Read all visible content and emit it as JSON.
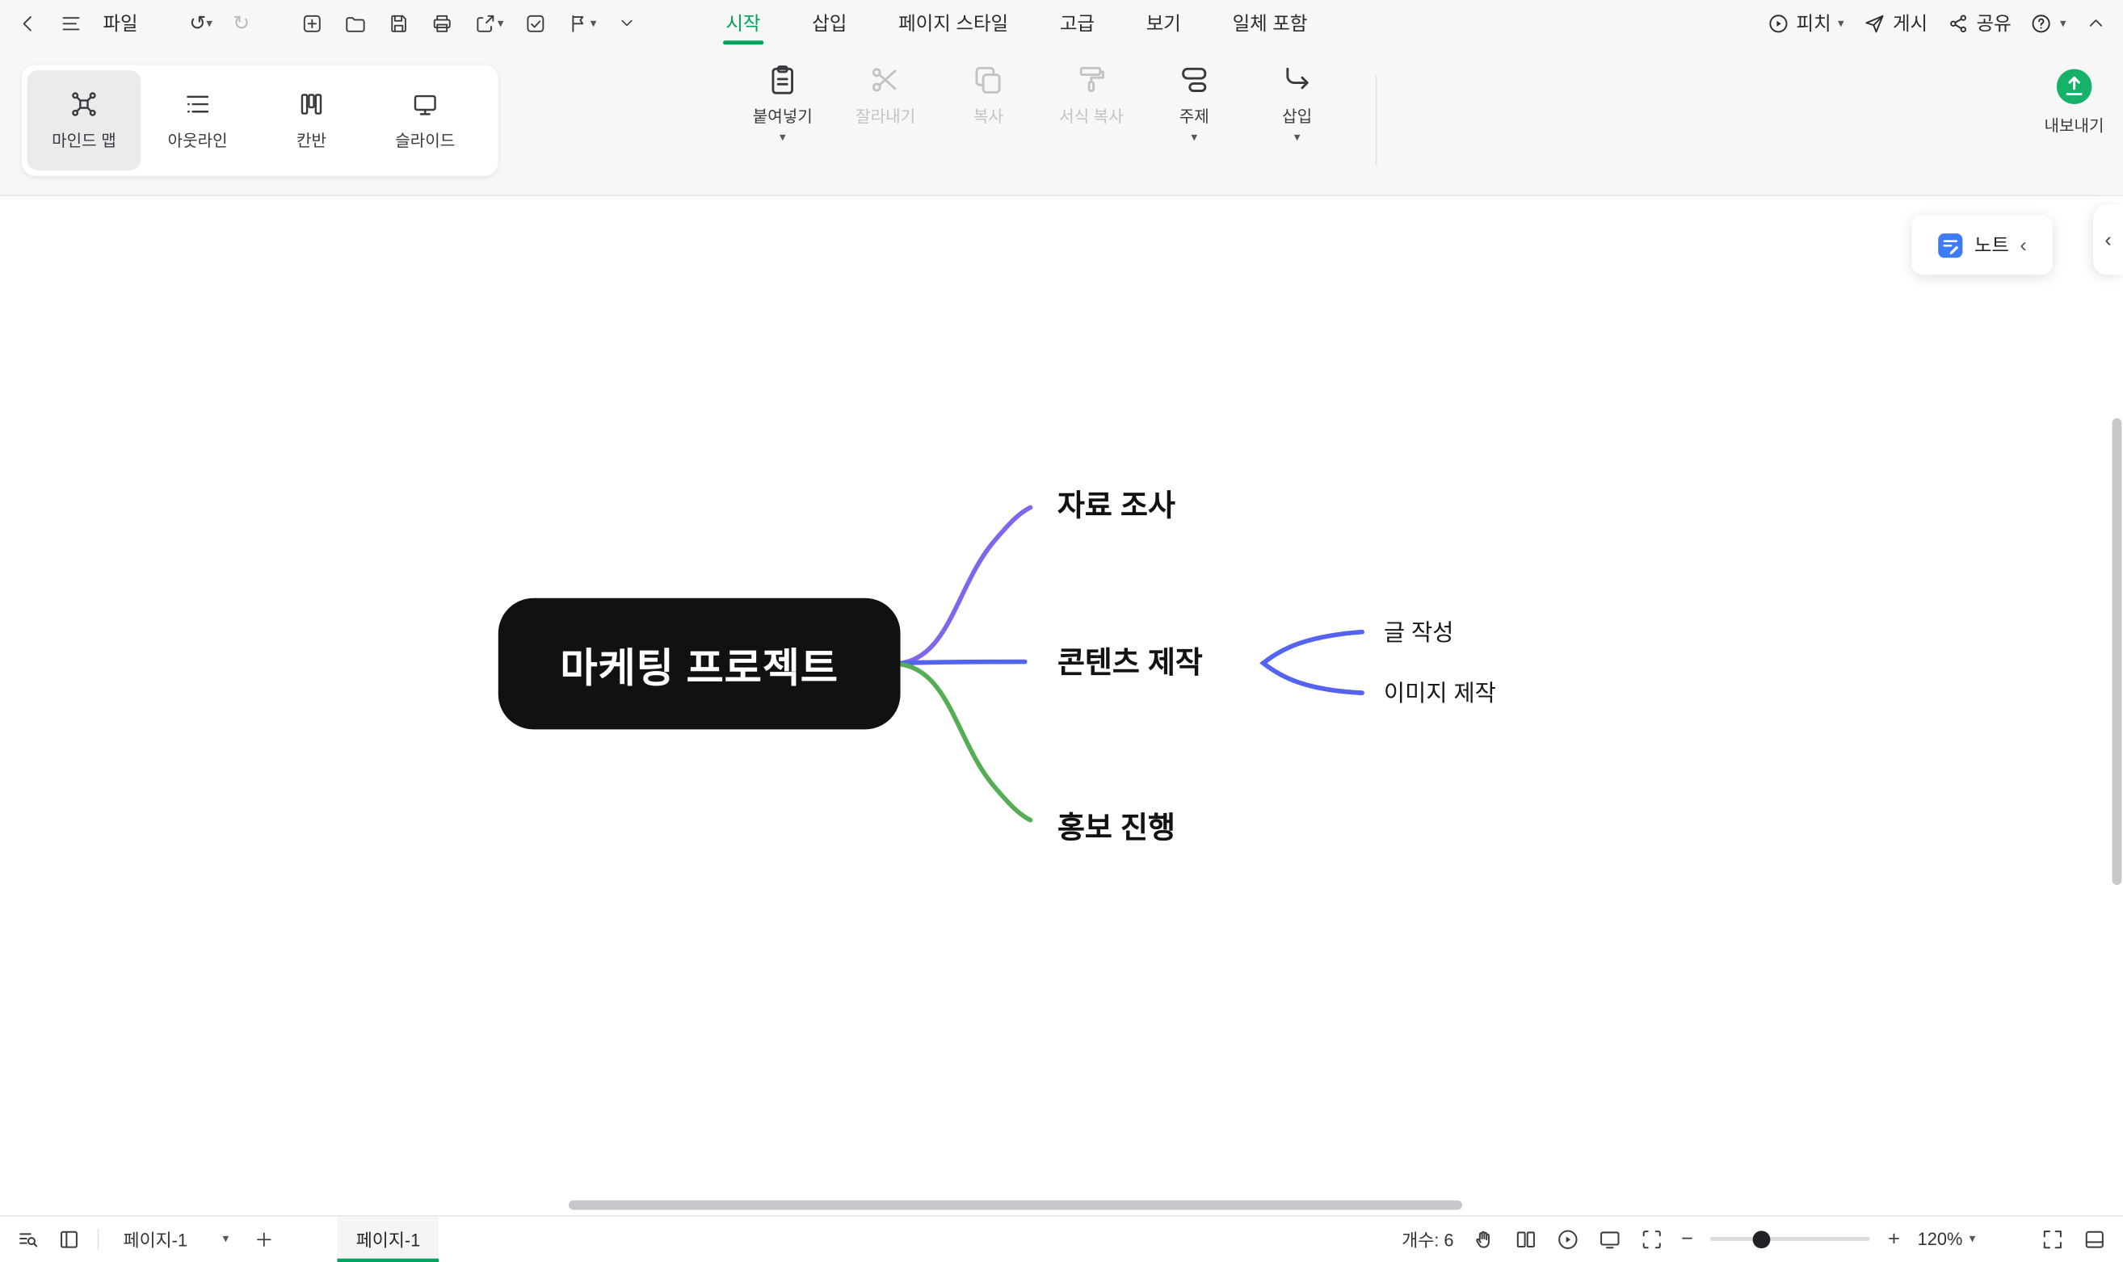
{
  "icons": {
    "undo": "↺",
    "redo": "↻",
    "caret_down": "▾",
    "chevron_left": "‹",
    "minus": "−",
    "plus": "+"
  },
  "colors": {
    "accent_green": "#00a45e",
    "export_green": "#17b26a",
    "note_blue": "#3e7bfa"
  },
  "menubar": {
    "file": "파일",
    "tabs": [
      {
        "label": "시작",
        "active": true
      },
      {
        "label": "삽입",
        "active": false
      },
      {
        "label": "페이지 스타일",
        "active": false
      },
      {
        "label": "고급",
        "active": false
      },
      {
        "label": "보기",
        "active": false
      },
      {
        "label": "일체 포함",
        "active": false
      }
    ],
    "pitch": "피치",
    "publish": "게시",
    "share": "공유"
  },
  "ribbon": {
    "view_modes": [
      {
        "label": "마인드 맵",
        "selected": true
      },
      {
        "label": "아웃라인",
        "selected": false
      },
      {
        "label": "칸반",
        "selected": false
      },
      {
        "label": "슬라이드",
        "selected": false
      }
    ],
    "tools": {
      "paste": "붙여넣기",
      "cut": "잘라내기",
      "copy": "복사",
      "format_paint": "서식 복사",
      "topic": "주제",
      "insert": "삽입"
    },
    "export": "내보내기"
  },
  "canvas": {
    "note": "노트",
    "mindmap": {
      "root": "마케팅 프로젝트",
      "root_bg": "#111111",
      "branches": [
        {
          "label": "자료 조사",
          "color": "#8166ec",
          "children": []
        },
        {
          "label": "콘텐츠 제작",
          "color": "#5463f0",
          "children": [
            {
              "label": "글 작성"
            },
            {
              "label": "이미지 제작"
            }
          ]
        },
        {
          "label": "홍보 진행",
          "color": "#55ae55",
          "children": []
        }
      ]
    }
  },
  "statusbar": {
    "page_select": "페이지-1",
    "page_tab": "페이지-1",
    "count": "개수: 6",
    "zoom": "120%"
  }
}
